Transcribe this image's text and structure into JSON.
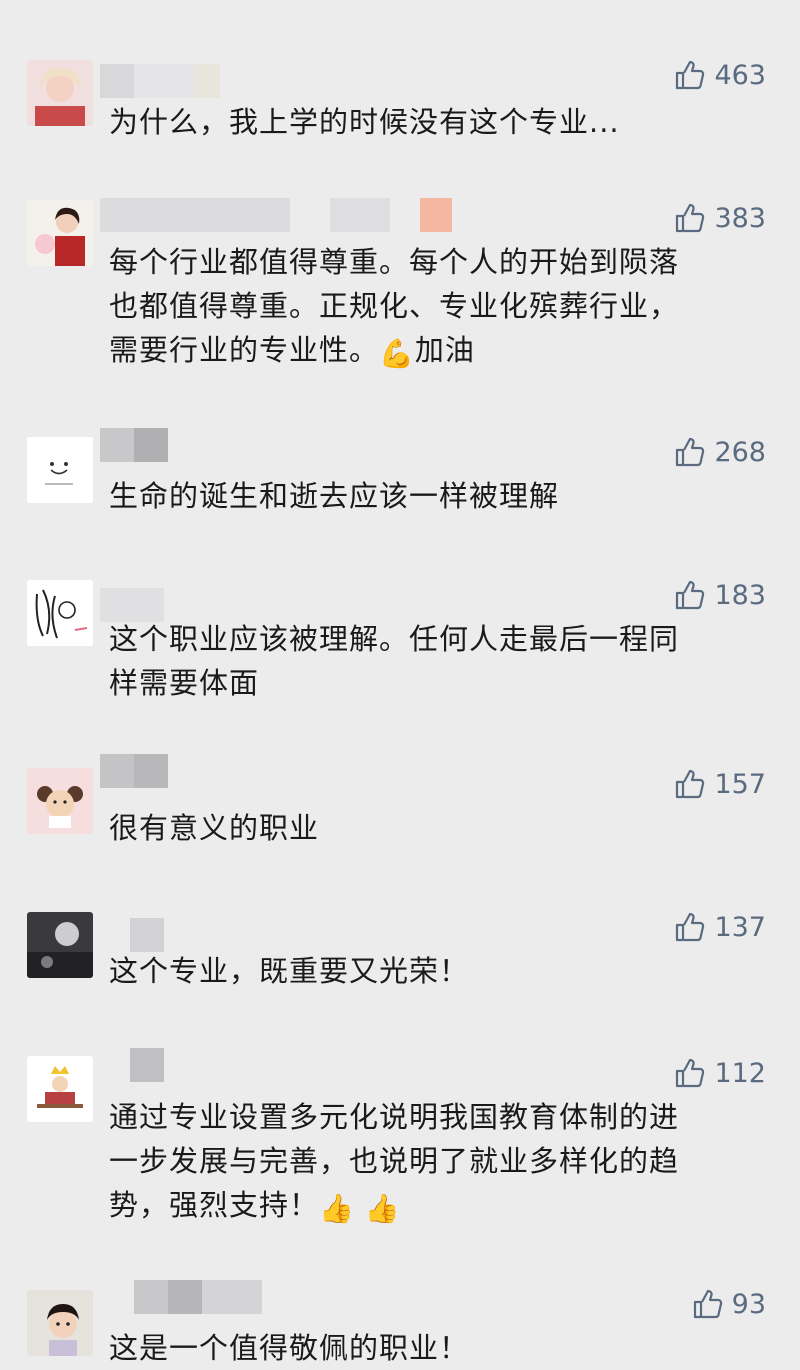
{
  "colors": {
    "background": "#ececed",
    "like_color": "#5b6b7f",
    "text_color": "#1a1a1a"
  },
  "comments": [
    {
      "likes": "463",
      "text": "为什么，我上学的时候没有这个专业..."
    },
    {
      "likes": "383",
      "text": "每个行业都值得尊重。每个人的开始到陨落\n也都值得尊重。正规化、专业化殡葬行业，\n需要行业的专业性。",
      "emoji": "💪",
      "after_emoji": "加油"
    },
    {
      "likes": "268",
      "text": "生命的诞生和逝去应该一样被理解"
    },
    {
      "likes": "183",
      "text": "这个职业应该被理解。任何人走最后一程同\n样需要体面"
    },
    {
      "likes": "157",
      "text": "很有意义的职业"
    },
    {
      "likes": "137",
      "text": "这个专业，既重要又光荣！"
    },
    {
      "likes": "112",
      "text": "通过专业设置多元化说明我国教育体制的进\n一步发展与完善，也说明了就业多样化的趋\n势，强烈支持！",
      "emoji": "👍 👍"
    },
    {
      "likes": "93",
      "text": "这是一个值得敬佩的职业！"
    }
  ],
  "icons": {
    "like": "thumbs-up-icon"
  }
}
